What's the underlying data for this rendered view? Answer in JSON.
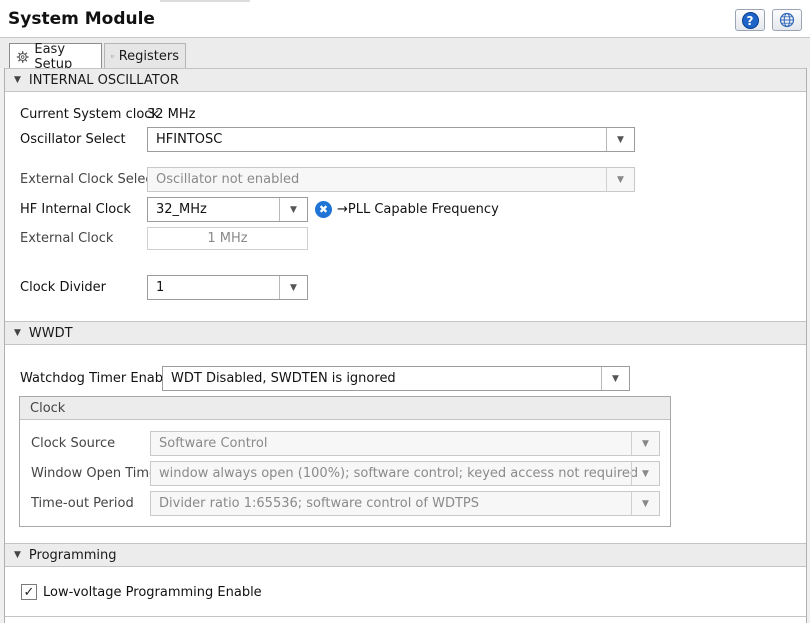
{
  "window": {
    "title": "System Module"
  },
  "toolbar": {
    "help_symbol": "?",
    "help_icon": "help-icon",
    "globe_icon": "globe-icon"
  },
  "tabs": [
    {
      "label": "Easy Setup",
      "icon": "gear-icon",
      "active": true
    },
    {
      "label": "Registers",
      "icon": "register-list-icon",
      "active": false
    }
  ],
  "oscillator": {
    "header": "INTERNAL OSCILLATOR",
    "current_clock_label": "Current System clock",
    "current_clock_value": "32 MHz",
    "osc_select_label": "Oscillator Select",
    "osc_select_value": "HFINTOSC",
    "ext_clock_select_label": "External Clock Select",
    "ext_clock_select_value": "Oscillator not enabled",
    "hf_clock_label": "HF Internal Clock",
    "hf_clock_value": "32_MHz",
    "hf_note": "→PLL Capable Frequency",
    "ext_clock_label": "External Clock",
    "ext_clock_value": "1 MHz",
    "divider_label": "Clock Divider",
    "divider_value": "1"
  },
  "wwdt": {
    "header": "WWDT",
    "enable_label": "Watchdog Timer Enable",
    "enable_value": "WDT Disabled, SWDTEN is ignored",
    "clock_group": "Clock",
    "source_label": "Clock Source",
    "source_value": "Software Control",
    "window_label": "Window Open Time",
    "window_value": "window always open (100%); software control; keyed access not required",
    "timeout_label": "Time-out Period",
    "timeout_value": "Divider ratio 1:65536; software control of WDTPS"
  },
  "programming": {
    "header": "Programming",
    "lvp_label": "Low-voltage Programming Enable",
    "lvp_checked": true,
    "check_symbol": "✓"
  },
  "colors": {
    "accent_blue": "#1f64c8",
    "section_bg": "#ececec"
  }
}
